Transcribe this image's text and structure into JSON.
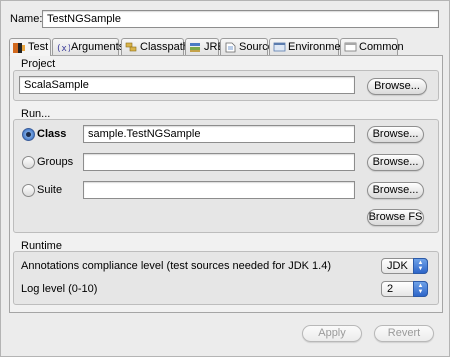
{
  "name": {
    "label": "Name:",
    "value": "TestNGSample"
  },
  "tabs": [
    {
      "label": "Test",
      "icon": "testng-icon"
    },
    {
      "label": "Arguments",
      "icon": "arguments-icon"
    },
    {
      "label": "Classpath",
      "icon": "classpath-icon"
    },
    {
      "label": "JRE",
      "icon": "jre-icon"
    },
    {
      "label": "Source",
      "icon": "source-icon"
    },
    {
      "label": "Environment",
      "icon": "environment-icon"
    },
    {
      "label": "Common",
      "icon": "common-icon"
    }
  ],
  "project": {
    "title": "Project",
    "value": "ScalaSample",
    "browse": "Browse..."
  },
  "run": {
    "title": "Run...",
    "class": {
      "label": "Class",
      "value": "sample.TestNGSample",
      "browse": "Browse...",
      "selected": true
    },
    "groups": {
      "label": "Groups",
      "value": "",
      "browse": "Browse..."
    },
    "suite": {
      "label": "Suite",
      "value": "",
      "browse": "Browse..."
    },
    "browse_fs": "Browse FS"
  },
  "runtime": {
    "title": "Runtime",
    "compliance_label": "Annotations compliance level (test sources needed for JDK 1.4)",
    "compliance_value": "JDK",
    "log_label": "Log level (0-10)",
    "log_value": "2"
  },
  "footer": {
    "apply": "Apply",
    "revert": "Revert"
  },
  "colors": {
    "radio_selected": "#3f76c8",
    "select_accent": "#2e66c9"
  }
}
